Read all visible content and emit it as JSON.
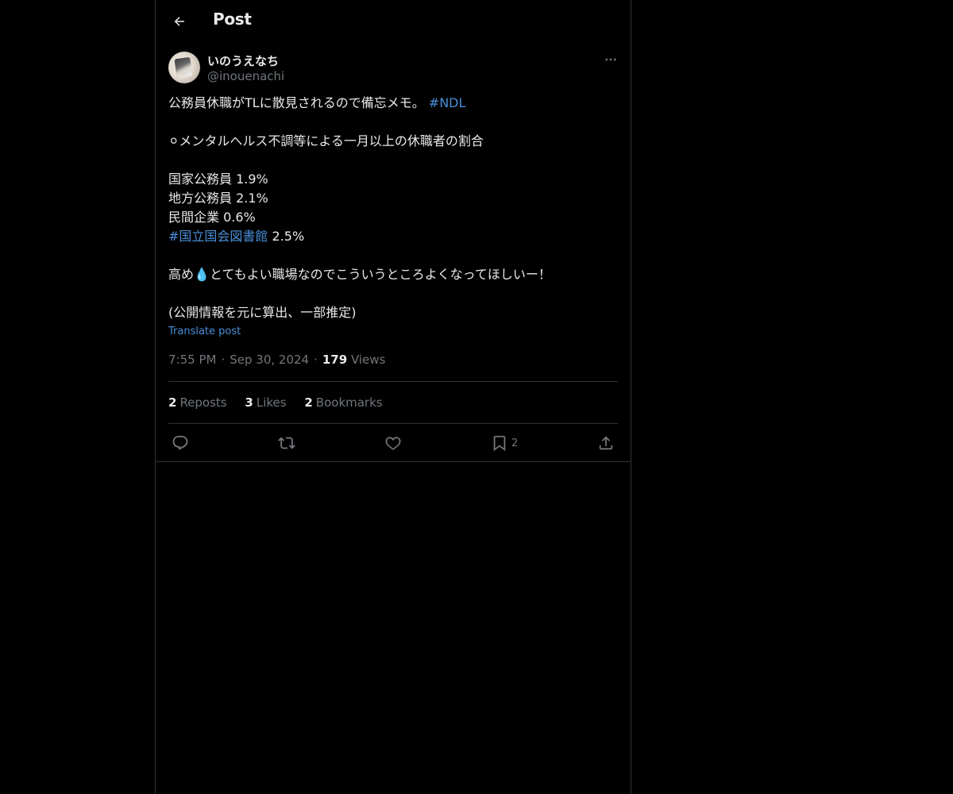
{
  "header": {
    "title": "Post"
  },
  "author": {
    "display_name": "いのうえなち",
    "handle": "@inouenachi"
  },
  "post": {
    "line1_text": "公務員休職がTLに散見されるので備忘メモ。",
    "line1_hashtag": "#NDL",
    "line2": "⚪︎メンタルヘルス不調等による一月以上の休職者の割合",
    "line3": "国家公務員 1.9%",
    "line4": "地方公務員 2.1%",
    "line5": "民間企業 0.6%",
    "line6_hashtag": "#国立国会図書館",
    "line6_text": " 2.5%",
    "line7_before": "高め",
    "line7_emoji": "💧",
    "line7_after": "とてもよい職場なのでこういうところよくなってほしいー！",
    "line8": "(公開情報を元に算出、一部推定)"
  },
  "translate_label": "Translate post",
  "meta": {
    "time": "7:55 PM",
    "date": "Sep 30, 2024",
    "views_count": "179",
    "views_label": "Views"
  },
  "stats": {
    "reposts_count": "2",
    "reposts_label": "Reposts",
    "likes_count": "3",
    "likes_label": "Likes",
    "bookmarks_count": "2",
    "bookmarks_label": "Bookmarks"
  },
  "actions": {
    "bookmark_count": "2"
  },
  "icons": {
    "back": "arrow-left-icon",
    "more": "more-horizontal-icon",
    "reply": "reply-icon",
    "repost": "repost-icon",
    "like": "heart-icon",
    "bookmark": "bookmark-icon",
    "share": "share-icon"
  },
  "colors": {
    "background": "#000000",
    "text": "#e7e9ea",
    "muted": "#71767b",
    "link": "#4a8fd9",
    "border": "#2f3336"
  }
}
